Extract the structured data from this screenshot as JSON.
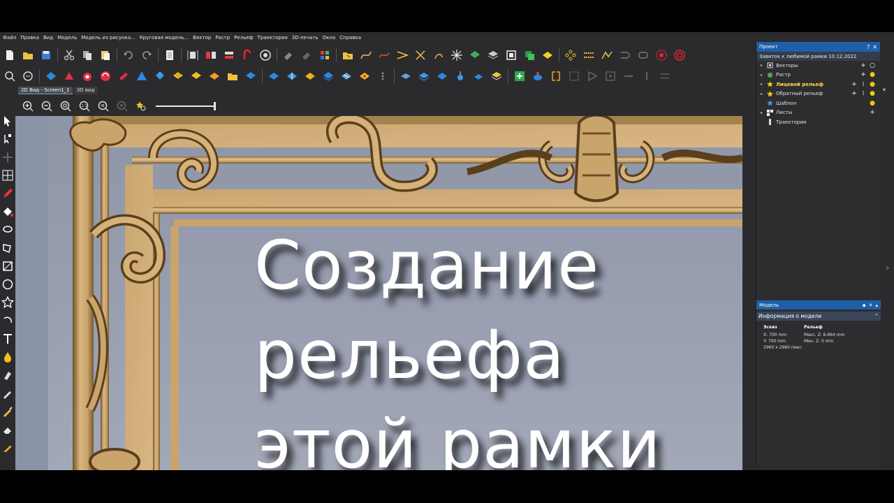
{
  "menu": [
    "Файл",
    "Правка",
    "Вид",
    "Модель",
    "Модель из рисунка...",
    "Круговая модель...",
    "Вектор",
    "Растр",
    "Рельеф",
    "Траектория",
    "3D-печать",
    "Окно",
    "Справка"
  ],
  "tabs": [
    {
      "label": "2D Вид - Screen1_1",
      "active": true
    },
    {
      "label": "3D вид",
      "active": false
    }
  ],
  "zoom_controls": {
    "zoom_one_label": "1:1"
  },
  "overlay": {
    "line1": "Создание",
    "line2": "рельефа",
    "line3": "этой рамки"
  },
  "project_panel": {
    "title": "Проект",
    "root": "Завиток к любимой рамки 10.12.2022",
    "items": [
      {
        "label": "Векторы",
        "bold": false
      },
      {
        "label": "Растр",
        "bold": false
      },
      {
        "label": "Лицевой рельеф",
        "bold": true
      },
      {
        "label": "Обратный рельеф",
        "bold": false
      },
      {
        "label": "Шаблон",
        "bold": false
      },
      {
        "label": "Листы",
        "bold": false
      },
      {
        "label": "Траектории",
        "bold": false
      }
    ]
  },
  "model_panel": {
    "title": "Модель"
  },
  "info_panel": {
    "title": "Информация о модели",
    "sketch": {
      "heading": "Эскиз",
      "x": "X: 700 mm",
      "y": "Y: 700 mm",
      "pixels": "2960 x 2960 пикс."
    },
    "relief": {
      "heading": "Рельеф",
      "max_z": "Макс. Z: 6.664 mm",
      "min_z": "Мин. Z: 0 mm"
    }
  },
  "colors": {
    "accent": "#1f5fa8",
    "wood": "#c9a46b",
    "bg": "#2b2b2d",
    "viewport": "#8e95a6"
  }
}
